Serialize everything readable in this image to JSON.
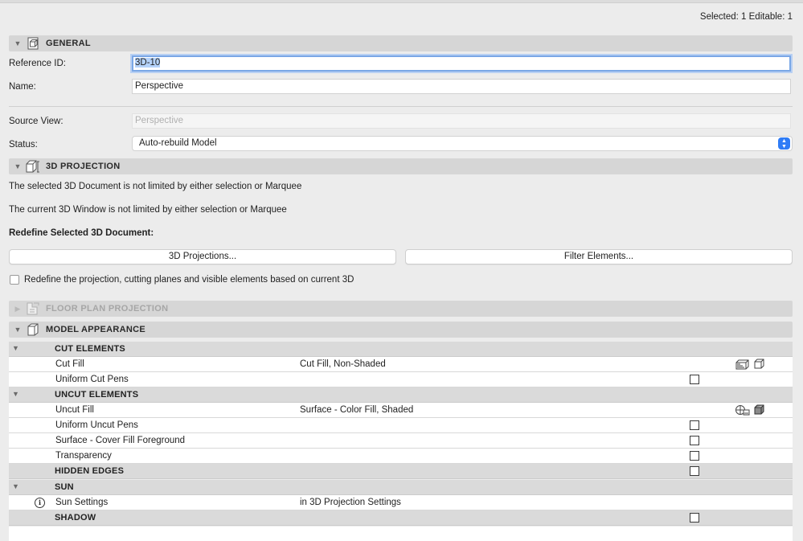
{
  "header": {
    "selection_info": "Selected: 1 Editable: 1"
  },
  "general": {
    "title": "GENERAL",
    "reference_id_label": "Reference ID:",
    "reference_id_value": "3D-10",
    "name_label": "Name:",
    "name_value": "Perspective",
    "source_view_label": "Source View:",
    "source_view_value": "Perspective",
    "status_label": "Status:",
    "status_value": "Auto-rebuild Model"
  },
  "projection": {
    "title": "3D PROJECTION",
    "msg_document": "The selected 3D Document is not limited by either selection or Marquee",
    "msg_window": "The current 3D Window is not limited by either selection or Marquee",
    "redefine_heading": "Redefine Selected 3D Document:",
    "btn_projections": "3D Projections...",
    "btn_filter": "Filter Elements...",
    "redefine_checkbox_label": "Redefine the projection, cutting planes and visible elements based on current 3D"
  },
  "floor_plan": {
    "title": "FLOOR PLAN PROJECTION"
  },
  "model_appearance": {
    "title": "MODEL APPEARANCE",
    "rows": {
      "cut_elements": "CUT ELEMENTS",
      "cut_fill": {
        "label": "Cut Fill",
        "value": "Cut Fill, Non-Shaded"
      },
      "uniform_cut_pens": {
        "label": "Uniform Cut Pens"
      },
      "uncut_elements": "UNCUT ELEMENTS",
      "uncut_fill": {
        "label": "Uncut Fill",
        "value": "Surface - Color Fill, Shaded"
      },
      "uniform_uncut_pens": {
        "label": "Uniform Uncut Pens"
      },
      "surface_cover": {
        "label": "Surface - Cover Fill Foreground"
      },
      "transparency": {
        "label": "Transparency"
      },
      "hidden_edges": "HIDDEN EDGES",
      "sun": "SUN",
      "sun_settings": {
        "label": "Sun Settings",
        "value": "in 3D Projection Settings"
      },
      "shadow": "SHADOW"
    }
  },
  "icons": {
    "expanded": "triangle-down",
    "collapsed": "triangle-right",
    "dropdown": "updown-arrows",
    "info": "info-circle"
  },
  "colors": {
    "accent": "#2f7cf6",
    "focus": "#7aa7e6"
  }
}
